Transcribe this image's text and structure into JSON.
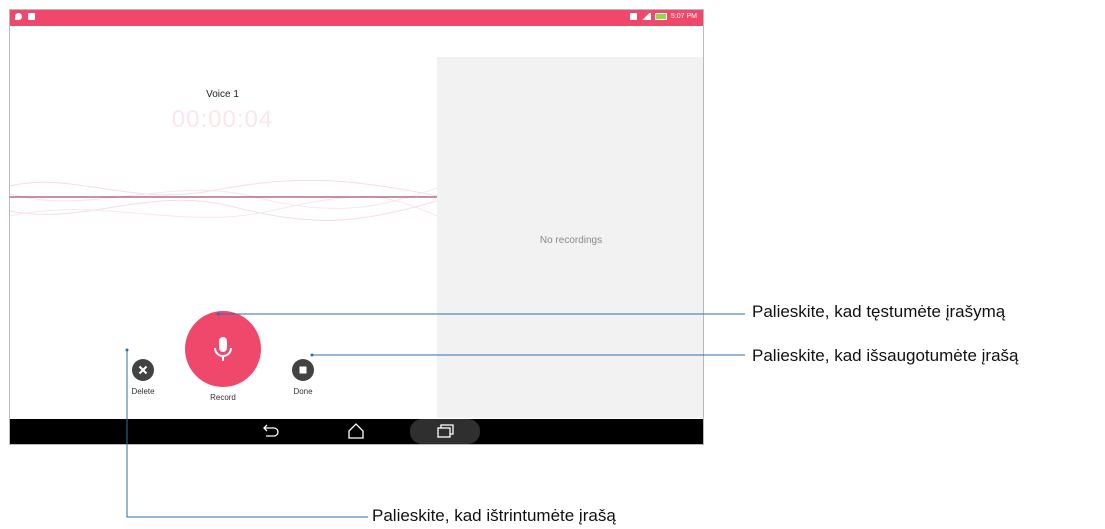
{
  "status_bar": {
    "time": "5:07 PM",
    "left_icons": [
      "location-icon",
      "message-icon"
    ],
    "right_icons": [
      "sd-icon",
      "signal-icon",
      "battery-icon"
    ]
  },
  "recorder": {
    "recording_name": "Voice 1",
    "timer": "00:00:04",
    "controls": {
      "delete_label": "Delete",
      "record_label": "Record",
      "done_label": "Done"
    }
  },
  "recordings": {
    "empty_text": "No recordings"
  },
  "nav_bar": {
    "buttons": [
      "back-icon",
      "home-icon",
      "recent-apps-icon"
    ]
  },
  "callouts": {
    "pause": "Palieskite, kad tęstumėte įrašymą",
    "save": "Palieskite, kad išsaugotumėte įrašą",
    "delete": "Palieskite, kad ištrintumėte įrašą"
  },
  "colors": {
    "accent": "#f0486b",
    "control_dark": "#424242",
    "waveform_line": "#8b2252",
    "panel_bg": "#f2f2f2"
  }
}
